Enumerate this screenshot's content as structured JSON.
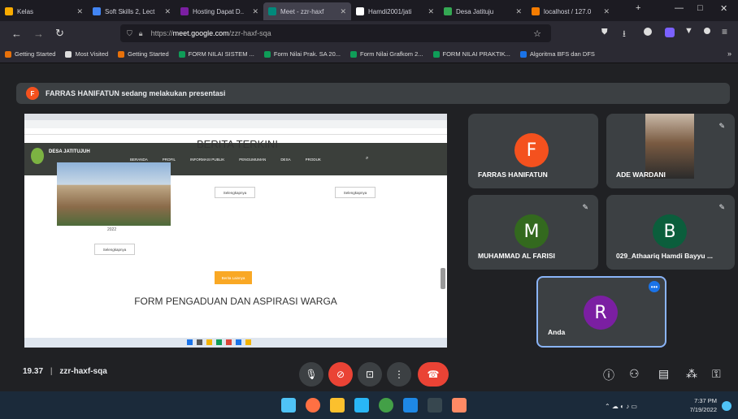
{
  "tabs": [
    {
      "label": "Kelas",
      "color": "#f9ab00"
    },
    {
      "label": "Soft Skills 2, Lect",
      "color": "#4285f4"
    },
    {
      "label": "Hosting Dapat D..",
      "color": "#7b1fa2"
    },
    {
      "label": "Meet - zzr-haxf",
      "color": "#00897b"
    },
    {
      "label": "Hamdi2001/jati",
      "color": "#ffffff"
    },
    {
      "label": "Desa Jatituju",
      "color": "#34a853"
    },
    {
      "label": "localhost / 127.0",
      "color": "#f57c00"
    }
  ],
  "url": {
    "prefix": "https://",
    "domain": "meet.google.com",
    "path": "/zzr-haxf-sqa"
  },
  "bookmarks": [
    "Getting Started",
    "Most Visited",
    "Getting Started",
    "FORM NILAI SISTEM ...",
    "Form Nilai Prak. SA 20...",
    "Form Nilai Grafkom 2...",
    "FORM NILAI PRAKTIK...",
    "Algoritma BFS dan DFS"
  ],
  "banner": {
    "initial": "F",
    "text": "FARRAS HANIFATUN sedang melakukan presentasi"
  },
  "presentation": {
    "heading": "BERITA TERKINI",
    "site_name": "DESA JATITUJUH",
    "nav": [
      "BERANDA",
      "PROFIL",
      "INFORMASI PUBLIK",
      "PENGUMUMAN",
      "DESA",
      "PRODUK"
    ],
    "read_more": "Selengkapnya",
    "more_button": "Berita Lainnya",
    "form_title": "FORM PENGADUAN DAN ASPIRASI WARGA",
    "card_caption": "2022"
  },
  "participants": [
    {
      "name": "FARRAS HANIFATUN",
      "initial": "F",
      "color": "#f4511e",
      "muted": false
    },
    {
      "name": "ADE WARDANI",
      "initial": "",
      "color": "#5a4a3a",
      "muted": true
    },
    {
      "name": "MUHAMMAD AL FARISI",
      "initial": "M",
      "color": "#33691e",
      "muted": true
    },
    {
      "name": "029_Athaariq Hamdi Bayyu ...",
      "initial": "B",
      "color": "#0b5e3c",
      "muted": true
    },
    {
      "name": "Anda",
      "initial": "R",
      "color": "#7b1fa2",
      "muted": false
    }
  ],
  "meeting": {
    "time": "19.37",
    "code": "zzr-haxf-sqa"
  },
  "clock": {
    "time": "7:37 PM",
    "date": "7/19/2022"
  }
}
